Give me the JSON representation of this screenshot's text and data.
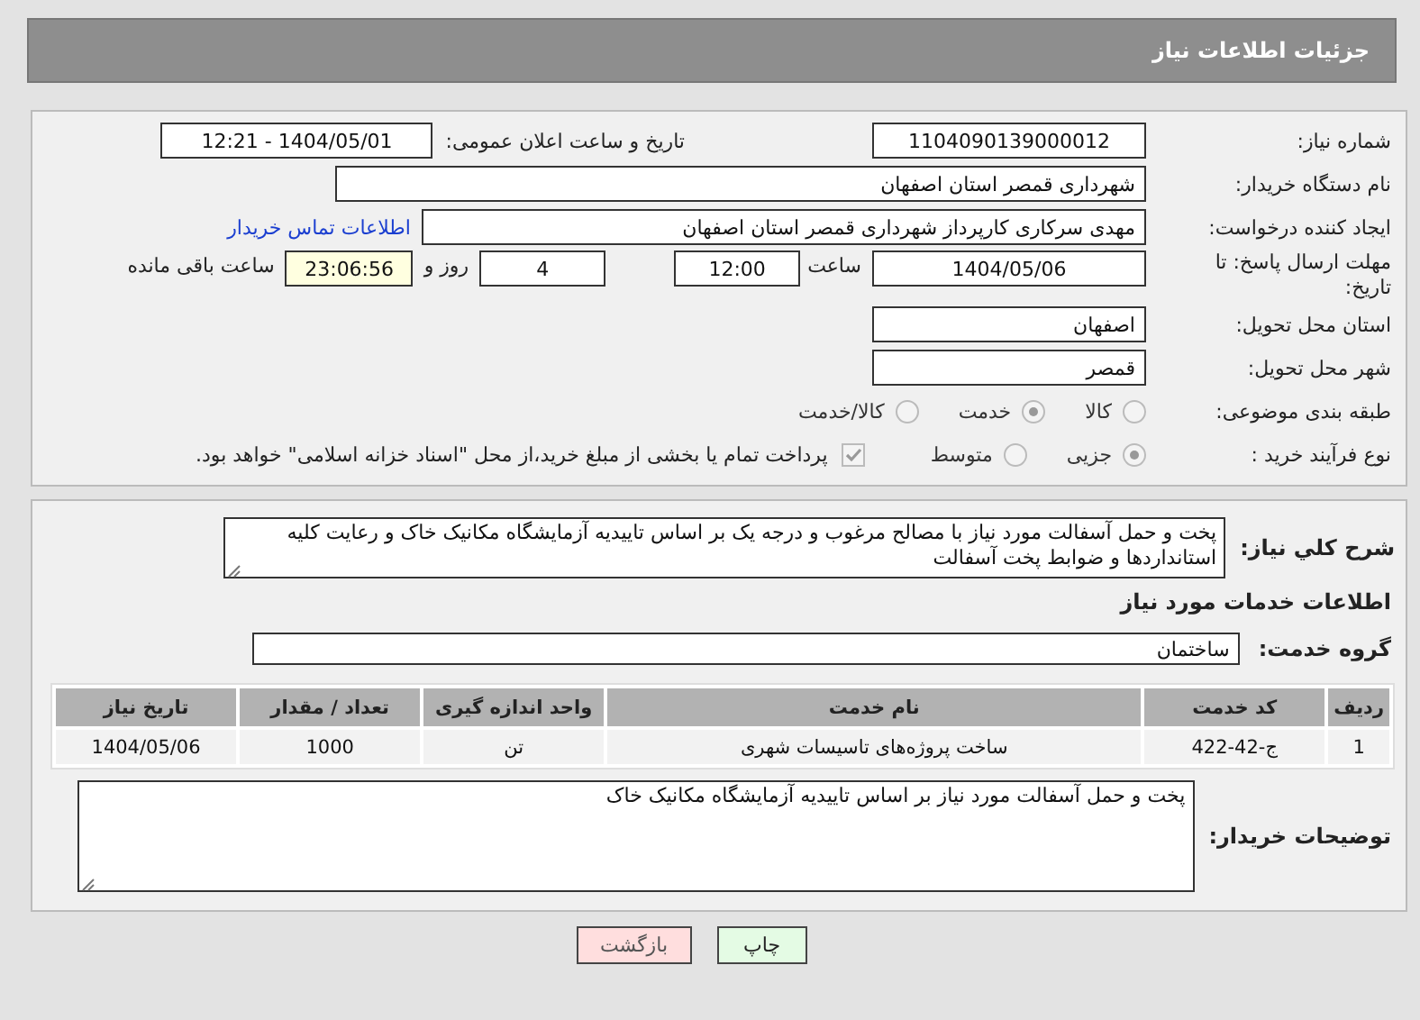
{
  "header": {
    "title": "جزئیات اطلاعات نیاز"
  },
  "details": {
    "need_number": {
      "label": "شماره نیاز:",
      "value": "1104090139000012"
    },
    "announce": {
      "label": "تاریخ و ساعت اعلان عمومی:",
      "value": "1404/05/01 - 12:21"
    },
    "buyer_org": {
      "label": "نام دستگاه خریدار:",
      "value": "شهرداری قمصر استان اصفهان"
    },
    "requester": {
      "label": "ایجاد کننده درخواست:",
      "value": "مهدی سرکاری کارپرداز شهرداری قمصر استان اصفهان",
      "link": "اطلاعات تماس خریدار"
    },
    "deadline": {
      "label": "مهلت ارسال پاسخ: تا تاریخ:",
      "date": "1404/05/06",
      "time_label": "ساعت",
      "time": "12:00",
      "days": "4",
      "days_label": "روز و",
      "remaining": "23:06:56",
      "remaining_label": "ساعت باقی مانده"
    },
    "province": {
      "label": "استان محل تحویل:",
      "value": "اصفهان"
    },
    "city": {
      "label": "شهر محل تحویل:",
      "value": "قمصر"
    },
    "category": {
      "label": "طبقه بندی موضوعی:",
      "options": [
        {
          "label": "کالا",
          "selected": false
        },
        {
          "label": "خدمت",
          "selected": true
        },
        {
          "label": "کالا/خدمت",
          "selected": false
        }
      ]
    },
    "process": {
      "label": "نوع فرآیند خرید :",
      "options": [
        {
          "label": "جزیی",
          "selected": true
        },
        {
          "label": "متوسط",
          "selected": false
        }
      ],
      "payment": {
        "checked": true,
        "text": "پرداخت تمام یا بخشی از مبلغ خرید،از محل \"اسناد خزانه اسلامی\" خواهد بود."
      }
    }
  },
  "services": {
    "description": {
      "label": "شرح کلي نياز:",
      "value": "پخت و حمل آسفالت مورد نیاز با مصالح مرغوب و درجه یک بر اساس تاییدیه آزمایشگاه مکانیک خاک و رعایت کلیه استانداردها و ضوابط پخت آسفالت"
    },
    "section_title": "اطلاعات خدمات مورد نیاز",
    "group": {
      "label": "گروه خدمت:",
      "value": "ساختمان"
    },
    "table": {
      "columns": [
        "ردیف",
        "کد خدمت",
        "نام خدمت",
        "واحد اندازه گیری",
        "تعداد / مقدار",
        "تاریخ نیاز"
      ],
      "rows": [
        [
          "1",
          "ج-42-422",
          "ساخت پروژه‌های تاسیسات شهری",
          "تن",
          "1000",
          "1404/05/06"
        ]
      ]
    },
    "notes": {
      "label": "توضیحات خریدار:",
      "value": "پخت و حمل آسفالت مورد نیاز بر اساس تاییدیه آزمایشگاه مکانیک خاک"
    }
  },
  "buttons": [
    {
      "label": "چاپ",
      "kind": "print"
    },
    {
      "label": "بازگشت",
      "kind": "back"
    }
  ]
}
